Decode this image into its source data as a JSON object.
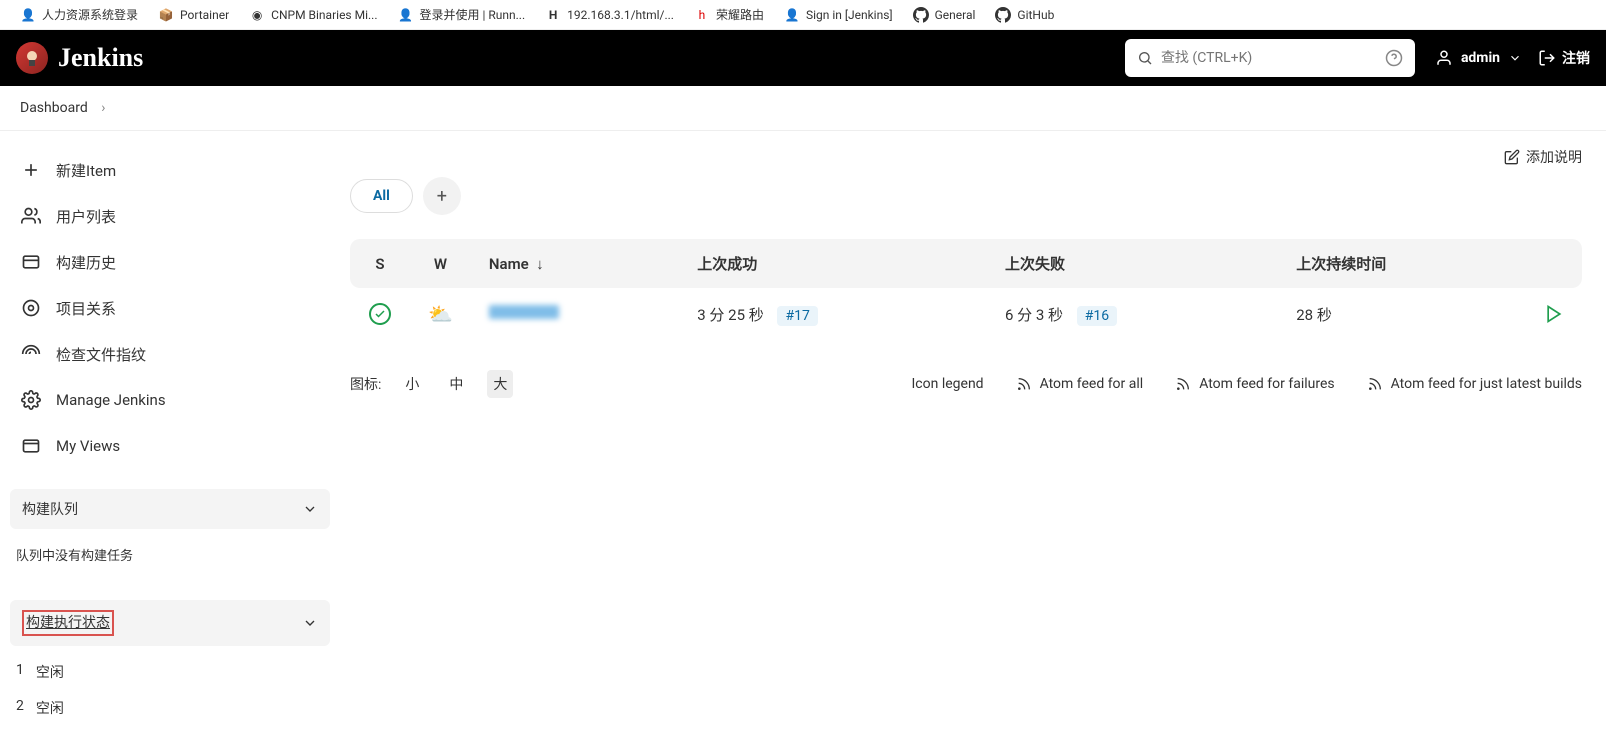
{
  "bookmarks": [
    {
      "label": "人力资源系统登录",
      "icon": "jenkins"
    },
    {
      "label": "Portainer",
      "icon": "portainer"
    },
    {
      "label": "CNPM Binaries Mi...",
      "icon": "cnpm"
    },
    {
      "label": "登录并使用 | Runn...",
      "icon": "jenkins"
    },
    {
      "label": "192.168.3.1/html/...",
      "icon": "h"
    },
    {
      "label": "荣耀路由",
      "icon": "honor"
    },
    {
      "label": "Sign in [Jenkins]",
      "icon": "jenkins"
    },
    {
      "label": "General",
      "icon": "github"
    },
    {
      "label": "GitHub",
      "icon": "github"
    }
  ],
  "header": {
    "logo_text": "Jenkins",
    "search_placeholder": "查找 (CTRL+K)",
    "user": "admin",
    "logout": "注销"
  },
  "breadcrumb": {
    "dashboard": "Dashboard"
  },
  "sidebar": {
    "items": [
      {
        "label": "新建Item"
      },
      {
        "label": "用户列表"
      },
      {
        "label": "构建历史"
      },
      {
        "label": "项目关系"
      },
      {
        "label": "检查文件指纹"
      },
      {
        "label": "Manage Jenkins"
      },
      {
        "label": "My Views"
      }
    ],
    "queue_title": "构建队列",
    "queue_empty": "队列中没有构建任务",
    "executor_title": "构建执行状态",
    "executors": [
      {
        "num": "1",
        "status": "空闲"
      },
      {
        "num": "2",
        "status": "空闲"
      }
    ]
  },
  "content": {
    "add_description": "添加说明",
    "tabs": {
      "all": "All"
    },
    "table": {
      "headers": {
        "s": "S",
        "w": "W",
        "name": "Name",
        "last_success": "上次成功",
        "last_failure": "上次失败",
        "last_duration": "上次持续时间"
      },
      "rows": [
        {
          "name_blurred": true,
          "last_success_text": "3 分 25 秒",
          "last_success_build": "#17",
          "last_failure_text": "6 分 3 秒",
          "last_failure_build": "#16",
          "duration": "28 秒"
        }
      ]
    },
    "footer": {
      "icon_label": "图标:",
      "sizes": {
        "s": "小",
        "m": "中",
        "l": "大"
      },
      "icon_legend": "Icon legend",
      "feed_all": "Atom feed for all",
      "feed_failures": "Atom feed for failures",
      "feed_latest": "Atom feed for just latest builds"
    }
  }
}
